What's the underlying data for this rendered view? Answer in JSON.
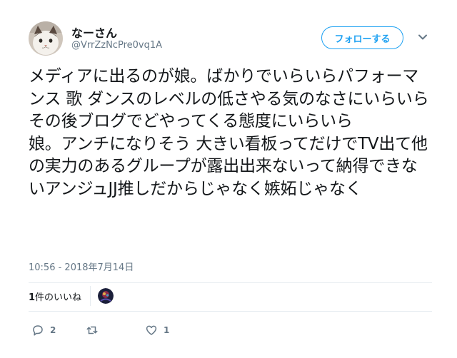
{
  "user": {
    "display_name": "なーさん",
    "handle": "@VrrZzNcPre0vq1A",
    "avatar_icon": "cat-avatar"
  },
  "header": {
    "follow_label": "フォローする",
    "menu_icon": "chevron-down-icon"
  },
  "tweet": {
    "text": "メディアに出るのが娘。ばかりでいらいらパフォーマンス 歌 ダンスのレベルの低さやる気のなさにいらいらその後ブログでどやってくる態度にいらいら\n娘。アンチになりそう 大きい看板ってだけでTV出て他の実力のあるグループが露出出来ないって納得できないアンジュJJ推しだからじゃなく嫉妬じゃなく",
    "timestamp": "10:56 - 2018年7月14日"
  },
  "likes": {
    "count": "1",
    "label": "件のいいね"
  },
  "actions": {
    "reply_count": "2",
    "retweet_count": "",
    "like_count": "1"
  },
  "colors": {
    "accent": "#1da1f2",
    "muted": "#657786",
    "text": "#14171a",
    "divider": "#e6ecf0"
  }
}
